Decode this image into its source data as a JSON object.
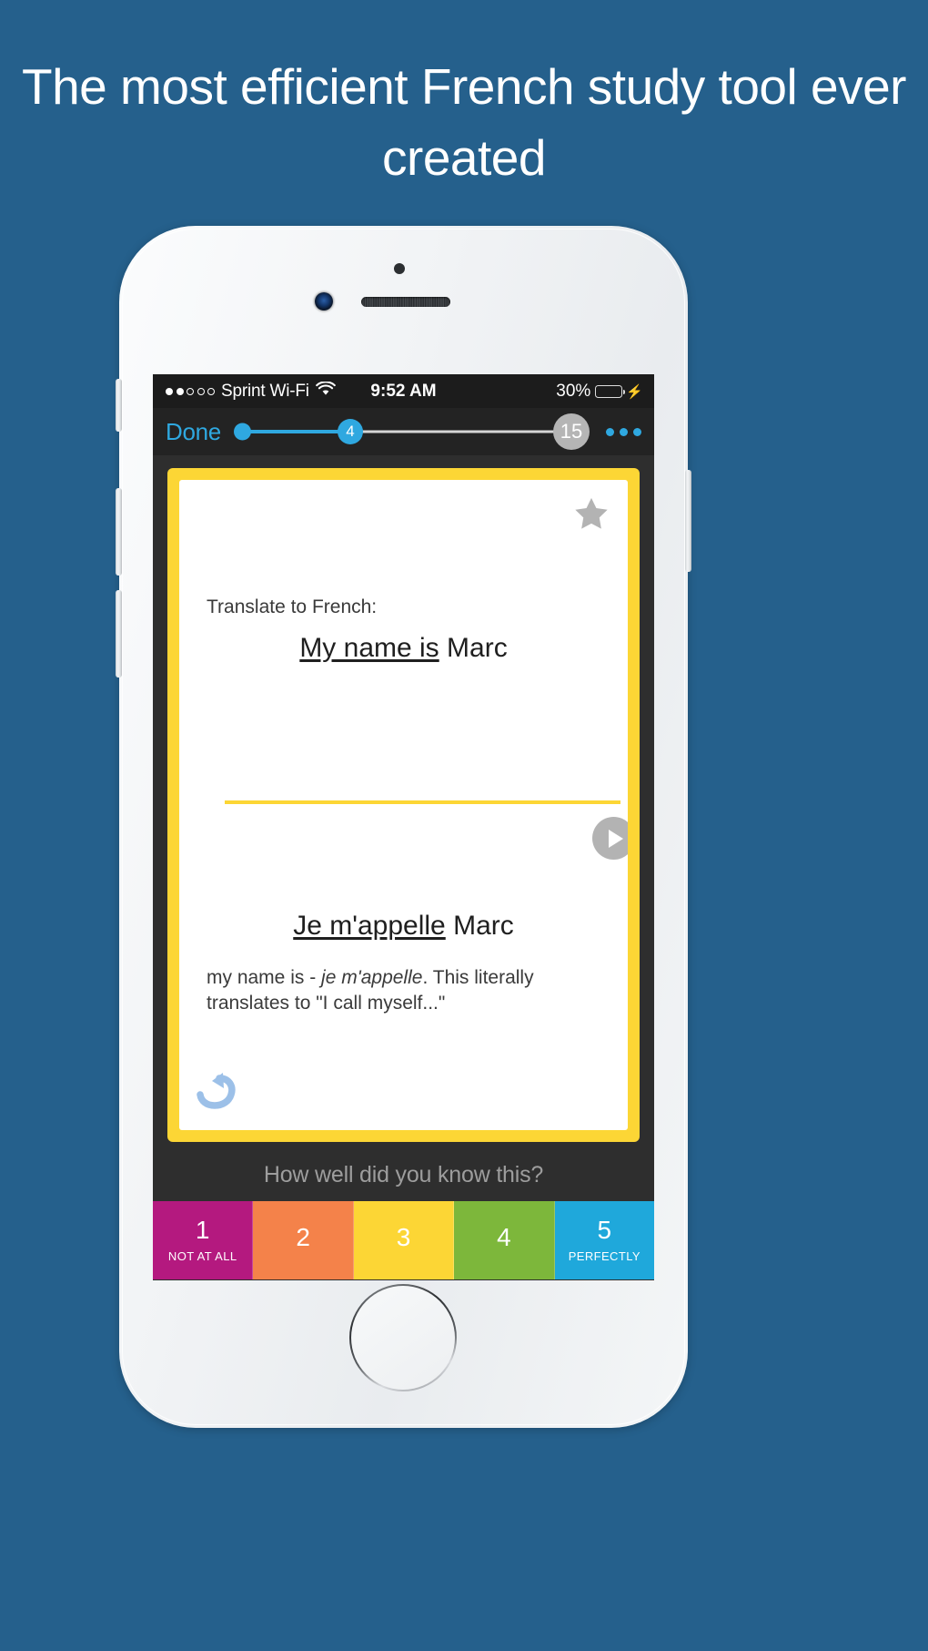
{
  "headline": "The most efficient French study tool ever created",
  "theme": {
    "page_background": "#25608c",
    "card_border": "#fcd635",
    "accent_blue": "#2fa8e0",
    "app_background": "#2e2e2e"
  },
  "phone": {
    "hardware": {
      "speaker": "speaker-grille",
      "sensor": "proximity-sensor",
      "camera": "front-camera",
      "home": "home-button",
      "buttons": [
        "mute-switch",
        "volume-down-button",
        "volume-up-button",
        "power-button"
      ]
    }
  },
  "status_bar": {
    "signal_dots_filled": 2,
    "signal_dots_total": 5,
    "carrier": "Sprint Wi-Fi",
    "wifi_icon": "wifi-icon",
    "time": "9:52 AM",
    "battery_percent": "30%",
    "battery_level": 30,
    "battery_color": "#4cd764",
    "charging_icon": "⚡"
  },
  "nav_bar": {
    "done_label": "Done",
    "progress": {
      "current": "4",
      "total": "15",
      "filled_color": "#2fa8e0",
      "rest_color": "#d5d5d5",
      "total_badge_color": "#b5b5b5"
    },
    "more_icon": "more-dots-icon"
  },
  "card": {
    "star_icon": "star-icon",
    "star_color": "#b3b3b3",
    "prompt": "Translate to French:",
    "question": {
      "underlined": "My name is",
      "rest": " Marc"
    },
    "play_icon": "play-icon",
    "answer": {
      "underlined": "Je m'appelle",
      "rest": " Marc"
    },
    "note": {
      "lead": "my name is - ",
      "italic": "je m'appelle",
      "tail": ". This literally translates to \"I call myself...\""
    },
    "undo_icon": "undo-arrow-icon",
    "undo_color": "#9cc0e8"
  },
  "rating": {
    "prompt": "How well did you know this?",
    "buttons": [
      {
        "number": "1",
        "sublabel": "NOT AT ALL",
        "color": "#b4197f"
      },
      {
        "number": "2",
        "sublabel": "",
        "color": "#f4824a"
      },
      {
        "number": "3",
        "sublabel": "",
        "color": "#fcd635"
      },
      {
        "number": "4",
        "sublabel": "",
        "color": "#7db73b"
      },
      {
        "number": "5",
        "sublabel": "PERFECTLY",
        "color": "#1fa8db"
      }
    ]
  }
}
